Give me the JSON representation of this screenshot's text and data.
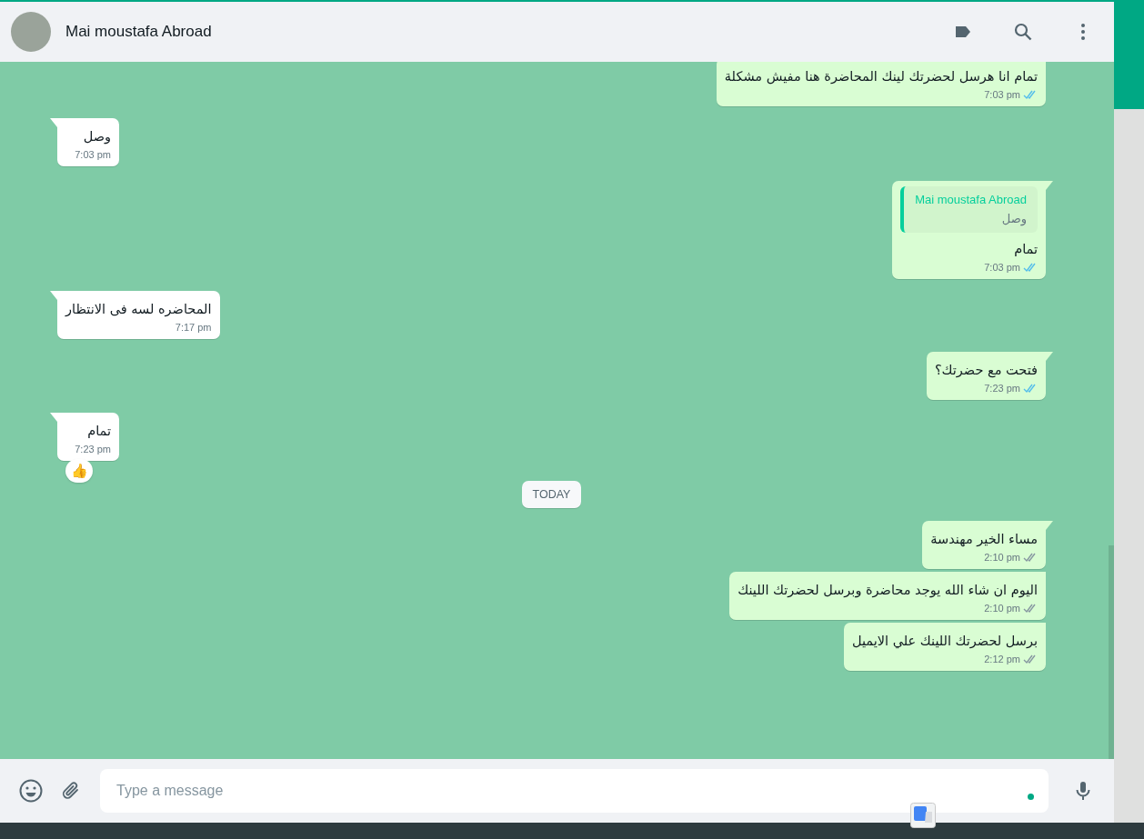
{
  "header": {
    "contact_name": "Mai moustafa Abroad"
  },
  "messages": [
    {
      "kind": "out",
      "text": "تمام انا هرسل لحضرتك لينك المحاضرة هنا مفيش مشكلة",
      "time": "7:03 pm",
      "read": true
    },
    {
      "kind": "in",
      "text": "وصل",
      "time": "7:03 pm"
    },
    {
      "kind": "out",
      "quote": {
        "author": "Mai moustafa Abroad",
        "text": "وصل"
      },
      "text": "تمام",
      "time": "7:03 pm",
      "read": true
    },
    {
      "kind": "in",
      "text": "المحاضره لسه فى الانتظار",
      "time": "7:17 pm"
    },
    {
      "kind": "out",
      "text": "فتحت مع حضرتك؟",
      "time": "7:23 pm",
      "read": true
    },
    {
      "kind": "in",
      "text": "تمام",
      "time": "7:23 pm",
      "reaction": "👍"
    },
    {
      "kind": "date",
      "text": "TODAY"
    },
    {
      "kind": "out",
      "text": "مساء الخير مهندسة",
      "time": "2:10 pm",
      "read": false
    },
    {
      "kind": "out",
      "text": "اليوم ان شاء الله يوجد محاضرة وبرسل لحضرتك اللينك",
      "time": "2:10 pm",
      "read": false
    },
    {
      "kind": "out",
      "text": "برسل لحضرتك اللينك علي الايميل",
      "time": "2:12 pm",
      "read": false
    }
  ],
  "composer": {
    "placeholder": "Type a message"
  }
}
